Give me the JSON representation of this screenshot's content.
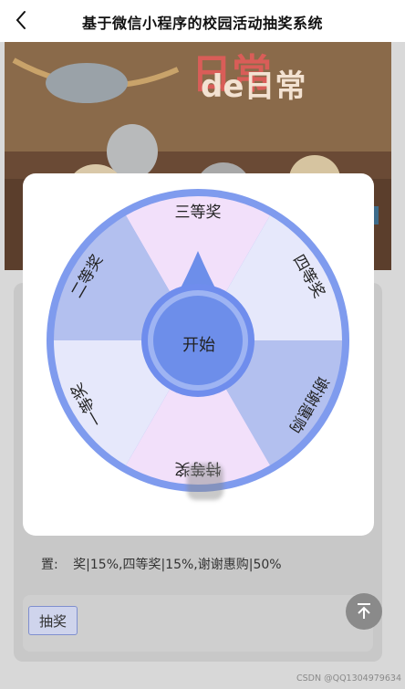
{
  "header": {
    "title": "基于微信小程序的校园活动抽奖系统"
  },
  "banner": {
    "title_line2": "de日常"
  },
  "wheel": {
    "start_label": "开始",
    "prizes": [
      "三等奖",
      "四等奖",
      "谢谢惠购",
      "特等奖",
      "一等奖",
      "二等奖"
    ],
    "colors": {
      "outer_ring": "#7f9bee",
      "segment_pink": "#f2e0fa",
      "segment_lavender": "#e6e8fb",
      "segment_blue": "#b3c0ef",
      "center_outer": "#6f8ded",
      "center_inner": "#9eb4f3",
      "center_core": "#6d8eea"
    }
  },
  "config": {
    "label": "置:",
    "value": "奖|15%,四等奖|15%,谢谢惠购|50%"
  },
  "actions": {
    "draw_label": "抽奖"
  },
  "watermark": "CSDN @QQ1304979634"
}
